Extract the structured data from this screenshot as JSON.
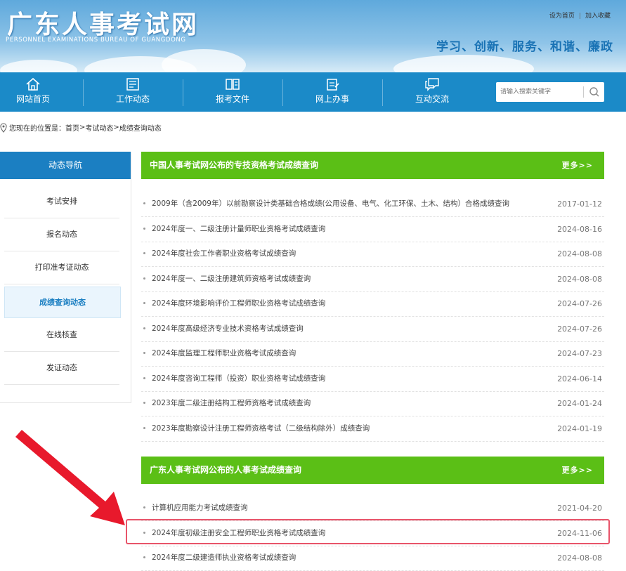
{
  "header": {
    "site_title": "广东人事考试网",
    "site_subtitle": "PERSONNEL EXAMINATIONS BUREAU OF GUANGDONG",
    "link_home": "设为首页",
    "link_sep": "|",
    "link_fav": "加入收藏",
    "slogan": "学习、创新、服务、和谐、廉政"
  },
  "nav": {
    "items": [
      {
        "label": "网站首页",
        "icon": "home-icon"
      },
      {
        "label": "工作动态",
        "icon": "newspaper-icon"
      },
      {
        "label": "报考文件",
        "icon": "book-icon"
      },
      {
        "label": "网上办事",
        "icon": "form-icon"
      },
      {
        "label": "互动交流",
        "icon": "chat-icon"
      }
    ],
    "search_placeholder": "请输入搜索关键字"
  },
  "breadcrumb": {
    "prefix": "您现在的位置是：",
    "home": "首页",
    "sep1": ">",
    "level1": "考试动态",
    "sep2": ">",
    "level2": "成绩查询动态"
  },
  "sidebar": {
    "title": "动态导航",
    "items": [
      {
        "label": "考试安排"
      },
      {
        "label": "报名动态"
      },
      {
        "label": "打印准考证动态"
      },
      {
        "label": "成绩查询动态",
        "active": true
      },
      {
        "label": "在线核查"
      },
      {
        "label": "发证动态"
      }
    ]
  },
  "section1": {
    "title": "中国人事考试网公布的专技资格考试成绩查询",
    "more": "更多>>",
    "items": [
      {
        "title": "2009年（含2009年）以前勘察设计类基础合格成绩(公用设备、电气、化工环保、土木、结构）合格成绩查询",
        "date": "2017-01-12"
      },
      {
        "title": "2024年度一、二级注册计量师职业资格考试成绩查询",
        "date": "2024-08-16"
      },
      {
        "title": "2024年度社会工作者职业资格考试成绩查询",
        "date": "2024-08-08"
      },
      {
        "title": "2024年度一、二级注册建筑师资格考试成绩查询",
        "date": "2024-08-08"
      },
      {
        "title": "2024年度环境影响评价工程师职业资格考试成绩查询",
        "date": "2024-07-26"
      },
      {
        "title": "2024年度高级经济专业技术资格考试成绩查询",
        "date": "2024-07-26"
      },
      {
        "title": "2024年度监理工程师职业资格考试成绩查询",
        "date": "2024-07-23"
      },
      {
        "title": "2024年度咨询工程师（投资）职业资格考试成绩查询",
        "date": "2024-06-14"
      },
      {
        "title": "2023年度二级注册结构工程师资格考试成绩查询",
        "date": "2024-01-24"
      },
      {
        "title": "2023年度勘察设计注册工程师资格考试（二级结构除外）成绩查询",
        "date": "2024-01-19"
      }
    ]
  },
  "section2": {
    "title": "广东人事考试网公布的人事考试成绩查询",
    "more": "更多>>",
    "items": [
      {
        "title": "计算机应用能力考试成绩查询",
        "date": "2021-04-20"
      },
      {
        "title": "2024年度初级注册安全工程师职业资格考试成绩查询",
        "date": "2024-11-06"
      },
      {
        "title": "2024年度二级建造师执业资格考试成绩查询",
        "date": "2024-08-08"
      }
    ]
  },
  "colors": {
    "nav_blue": "#1b8ac8",
    "section_green": "#5bbf16",
    "highlight_red": "#e8546a",
    "arrow_red": "#e8192c"
  }
}
